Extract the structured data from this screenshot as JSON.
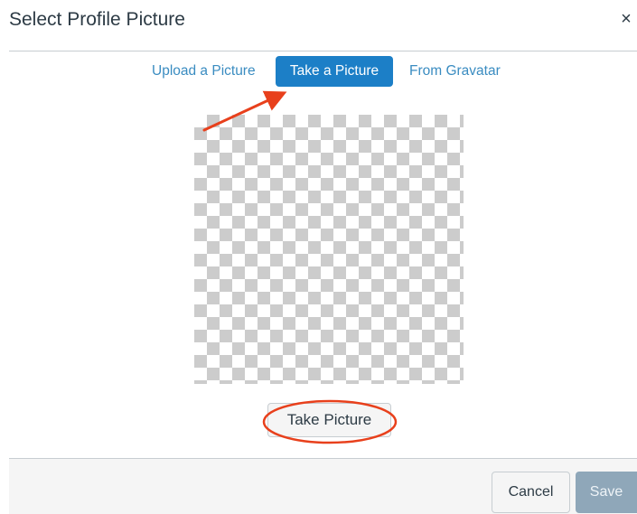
{
  "dialog": {
    "title": "Select Profile Picture",
    "close_glyph": "×"
  },
  "tabs": [
    {
      "label": "Upload a Picture",
      "active": false
    },
    {
      "label": "Take a Picture",
      "active": true
    },
    {
      "label": "From Gravatar",
      "active": false
    }
  ],
  "capture": {
    "button_label": "Take Picture"
  },
  "footer": {
    "cancel_label": "Cancel",
    "save_label": "Save",
    "save_disabled": true
  },
  "colors": {
    "active_tab": "#1c7fc7",
    "link": "#3a8cc1",
    "annotation": "#e8401c",
    "save_disabled": "#8fa7b9"
  }
}
